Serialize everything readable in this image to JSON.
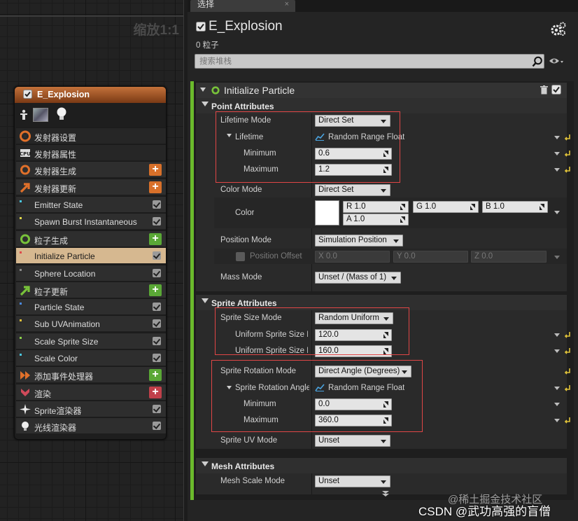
{
  "graph": {
    "zoom_label": "缩放1:1",
    "node": {
      "title": "E_Explosion",
      "rows": [
        {
          "label": "发射器设置",
          "icon": "emitter-settings-icon",
          "type": "header"
        },
        {
          "label": "发射器属性",
          "icon": "cpu-icon",
          "type": "header"
        },
        {
          "label": "发射器生成",
          "icon": "ring-icon",
          "type": "add",
          "btn": "+"
        },
        {
          "label": "发射器更新",
          "icon": "arrow-up-right-icon",
          "type": "add",
          "btn": "+"
        },
        {
          "label": "Emitter State",
          "type": "check"
        },
        {
          "label": "Spawn Burst Instantaneous",
          "type": "check"
        },
        {
          "label": "粒子生成",
          "icon": "ring-icon",
          "type": "add",
          "btn": "+"
        },
        {
          "label": "Initialize Particle",
          "type": "check",
          "selected": true
        },
        {
          "label": "Sphere Location",
          "type": "check"
        },
        {
          "label": "粒子更新",
          "icon": "arrow-up-right-icon",
          "type": "add",
          "btn": "+"
        },
        {
          "label": "Particle State",
          "type": "check"
        },
        {
          "label": "Sub UVAnimation",
          "type": "check"
        },
        {
          "label": "Scale Sprite Size",
          "type": "check"
        },
        {
          "label": "Scale Color",
          "type": "check"
        },
        {
          "label": "添加事件处理器",
          "icon": "event-handler-icon",
          "type": "add",
          "btn": "+"
        },
        {
          "label": "渲染",
          "icon": "render-icon",
          "type": "add",
          "btn": "+"
        },
        {
          "label": "Sprite渲染器",
          "icon": "sprite-burst-icon",
          "type": "check"
        },
        {
          "label": "光线渲染器",
          "icon": "light-bulb-icon",
          "type": "check"
        }
      ]
    }
  },
  "panel": {
    "tab_label": "选择",
    "tab_close": "×",
    "title": "E_Explosion",
    "particle_count": "0 粒子",
    "search_placeholder": "搜索堆栈",
    "module_title": "Initialize Particle",
    "sections": {
      "point": "Point Attributes",
      "sprite": "Sprite Attributes",
      "mesh": "Mesh Attributes"
    },
    "props": {
      "lifetime_mode_label": "Lifetime Mode",
      "lifetime_mode_value": "Direct Set",
      "lifetime_label": "Lifetime",
      "lifetime_value": "Random Range Float",
      "lifetime_min_label": "Minimum",
      "lifetime_min_value": "0.6",
      "lifetime_max_label": "Maximum",
      "lifetime_max_value": "1.2",
      "color_mode_label": "Color Mode",
      "color_mode_value": "Direct Set",
      "color_label": "Color",
      "color_r": "R 1.0",
      "color_g": "G 1.0",
      "color_b": "B 1.0",
      "color_a": "A 1.0",
      "position_mode_label": "Position Mode",
      "position_mode_value": "Simulation Position",
      "position_offset_label": "Position Offset",
      "pos_x": "X 0.0",
      "pos_y": "Y 0.0",
      "pos_z": "Z 0.0",
      "mass_mode_label": "Mass Mode",
      "mass_mode_value": "Unset / (Mass of 1)",
      "sprite_size_mode_label": "Sprite Size Mode",
      "sprite_size_mode_value": "Random Uniform",
      "uniform_min_label": "Uniform Sprite Size M",
      "uniform_min_value": "120.0",
      "uniform_max_label": "Uniform Sprite Size M",
      "uniform_max_value": "160.0",
      "sprite_rot_mode_label": "Sprite Rotation Mode",
      "sprite_rot_mode_value": "Direct Angle (Degrees)",
      "sprite_rot_angle_label": "Sprite Rotation Angle",
      "sprite_rot_angle_value": "Random Range Float",
      "rot_min_label": "Minimum",
      "rot_min_value": "0.0",
      "rot_max_label": "Maximum",
      "rot_max_value": "360.0",
      "sprite_uv_mode_label": "Sprite UV Mode",
      "sprite_uv_mode_value": "Unset",
      "mesh_scale_mode_label": "Mesh Scale Mode",
      "mesh_scale_mode_value": "Unset"
    },
    "colors": {
      "accent_green": "#6bba2c",
      "highlight_red": "#e04646",
      "selected_row": "#d6b890"
    }
  },
  "watermarks": {
    "juejin": "@稀土掘金技术社区",
    "csdn": "CSDN @武功高强的盲僧"
  }
}
